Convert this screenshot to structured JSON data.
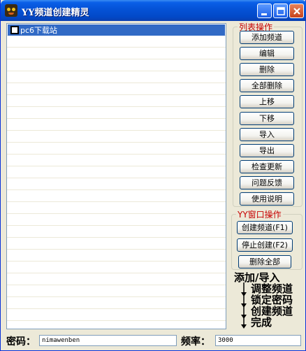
{
  "window": {
    "title": "YY频道创建精灵"
  },
  "titlebar": {
    "min": "minimize",
    "max": "maximize",
    "close": "close"
  },
  "list": {
    "items": [
      {
        "label": "pc6下载站",
        "checked": false,
        "selected": true
      }
    ]
  },
  "list_ops": {
    "legend": "列表操作",
    "buttons": [
      "添加频道",
      "编辑",
      "删除",
      "全部删除",
      "上移",
      "下移",
      "导入",
      "导出",
      "检查更新",
      "问题反馈",
      "使用说明"
    ]
  },
  "window_ops": {
    "legend": "YY窗口操作",
    "create": "创建频道(F1)",
    "stop": "停止创建(F2)",
    "delete_all": "删除全部"
  },
  "flow": {
    "steps": [
      "添加/导入",
      "调整频道",
      "锁定密码",
      "创建频道",
      "完成"
    ]
  },
  "password": {
    "label": "密码：",
    "value": "nimawenben"
  },
  "frequency": {
    "label": "频率：",
    "value": "3000"
  },
  "colors": {
    "accent": "#316ac5",
    "legend": "#c60000",
    "title_bar": "#0553d8"
  }
}
